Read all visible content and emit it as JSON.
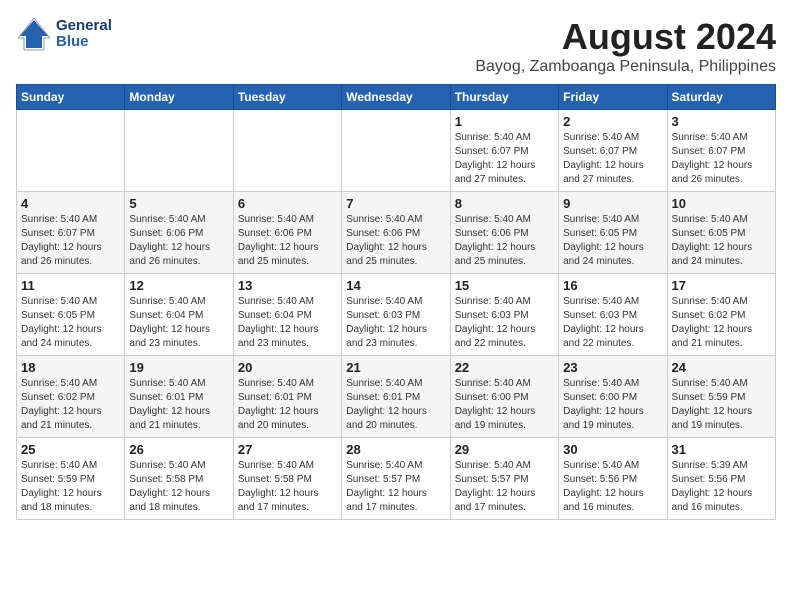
{
  "logo": {
    "line1": "General",
    "line2": "Blue"
  },
  "title": "August 2024",
  "subtitle": "Bayog, Zamboanga Peninsula, Philippines",
  "days_of_week": [
    "Sunday",
    "Monday",
    "Tuesday",
    "Wednesday",
    "Thursday",
    "Friday",
    "Saturday"
  ],
  "weeks": [
    [
      {
        "day": "",
        "info": ""
      },
      {
        "day": "",
        "info": ""
      },
      {
        "day": "",
        "info": ""
      },
      {
        "day": "",
        "info": ""
      },
      {
        "day": "1",
        "info": "Sunrise: 5:40 AM\nSunset: 6:07 PM\nDaylight: 12 hours\nand 27 minutes."
      },
      {
        "day": "2",
        "info": "Sunrise: 5:40 AM\nSunset: 6:07 PM\nDaylight: 12 hours\nand 27 minutes."
      },
      {
        "day": "3",
        "info": "Sunrise: 5:40 AM\nSunset: 6:07 PM\nDaylight: 12 hours\nand 26 minutes."
      }
    ],
    [
      {
        "day": "4",
        "info": "Sunrise: 5:40 AM\nSunset: 6:07 PM\nDaylight: 12 hours\nand 26 minutes."
      },
      {
        "day": "5",
        "info": "Sunrise: 5:40 AM\nSunset: 6:06 PM\nDaylight: 12 hours\nand 26 minutes."
      },
      {
        "day": "6",
        "info": "Sunrise: 5:40 AM\nSunset: 6:06 PM\nDaylight: 12 hours\nand 25 minutes."
      },
      {
        "day": "7",
        "info": "Sunrise: 5:40 AM\nSunset: 6:06 PM\nDaylight: 12 hours\nand 25 minutes."
      },
      {
        "day": "8",
        "info": "Sunrise: 5:40 AM\nSunset: 6:06 PM\nDaylight: 12 hours\nand 25 minutes."
      },
      {
        "day": "9",
        "info": "Sunrise: 5:40 AM\nSunset: 6:05 PM\nDaylight: 12 hours\nand 24 minutes."
      },
      {
        "day": "10",
        "info": "Sunrise: 5:40 AM\nSunset: 6:05 PM\nDaylight: 12 hours\nand 24 minutes."
      }
    ],
    [
      {
        "day": "11",
        "info": "Sunrise: 5:40 AM\nSunset: 6:05 PM\nDaylight: 12 hours\nand 24 minutes."
      },
      {
        "day": "12",
        "info": "Sunrise: 5:40 AM\nSunset: 6:04 PM\nDaylight: 12 hours\nand 23 minutes."
      },
      {
        "day": "13",
        "info": "Sunrise: 5:40 AM\nSunset: 6:04 PM\nDaylight: 12 hours\nand 23 minutes."
      },
      {
        "day": "14",
        "info": "Sunrise: 5:40 AM\nSunset: 6:03 PM\nDaylight: 12 hours\nand 23 minutes."
      },
      {
        "day": "15",
        "info": "Sunrise: 5:40 AM\nSunset: 6:03 PM\nDaylight: 12 hours\nand 22 minutes."
      },
      {
        "day": "16",
        "info": "Sunrise: 5:40 AM\nSunset: 6:03 PM\nDaylight: 12 hours\nand 22 minutes."
      },
      {
        "day": "17",
        "info": "Sunrise: 5:40 AM\nSunset: 6:02 PM\nDaylight: 12 hours\nand 21 minutes."
      }
    ],
    [
      {
        "day": "18",
        "info": "Sunrise: 5:40 AM\nSunset: 6:02 PM\nDaylight: 12 hours\nand 21 minutes."
      },
      {
        "day": "19",
        "info": "Sunrise: 5:40 AM\nSunset: 6:01 PM\nDaylight: 12 hours\nand 21 minutes."
      },
      {
        "day": "20",
        "info": "Sunrise: 5:40 AM\nSunset: 6:01 PM\nDaylight: 12 hours\nand 20 minutes."
      },
      {
        "day": "21",
        "info": "Sunrise: 5:40 AM\nSunset: 6:01 PM\nDaylight: 12 hours\nand 20 minutes."
      },
      {
        "day": "22",
        "info": "Sunrise: 5:40 AM\nSunset: 6:00 PM\nDaylight: 12 hours\nand 19 minutes."
      },
      {
        "day": "23",
        "info": "Sunrise: 5:40 AM\nSunset: 6:00 PM\nDaylight: 12 hours\nand 19 minutes."
      },
      {
        "day": "24",
        "info": "Sunrise: 5:40 AM\nSunset: 5:59 PM\nDaylight: 12 hours\nand 19 minutes."
      }
    ],
    [
      {
        "day": "25",
        "info": "Sunrise: 5:40 AM\nSunset: 5:59 PM\nDaylight: 12 hours\nand 18 minutes."
      },
      {
        "day": "26",
        "info": "Sunrise: 5:40 AM\nSunset: 5:58 PM\nDaylight: 12 hours\nand 18 minutes."
      },
      {
        "day": "27",
        "info": "Sunrise: 5:40 AM\nSunset: 5:58 PM\nDaylight: 12 hours\nand 17 minutes."
      },
      {
        "day": "28",
        "info": "Sunrise: 5:40 AM\nSunset: 5:57 PM\nDaylight: 12 hours\nand 17 minutes."
      },
      {
        "day": "29",
        "info": "Sunrise: 5:40 AM\nSunset: 5:57 PM\nDaylight: 12 hours\nand 17 minutes."
      },
      {
        "day": "30",
        "info": "Sunrise: 5:40 AM\nSunset: 5:56 PM\nDaylight: 12 hours\nand 16 minutes."
      },
      {
        "day": "31",
        "info": "Sunrise: 5:39 AM\nSunset: 5:56 PM\nDaylight: 12 hours\nand 16 minutes."
      }
    ]
  ]
}
